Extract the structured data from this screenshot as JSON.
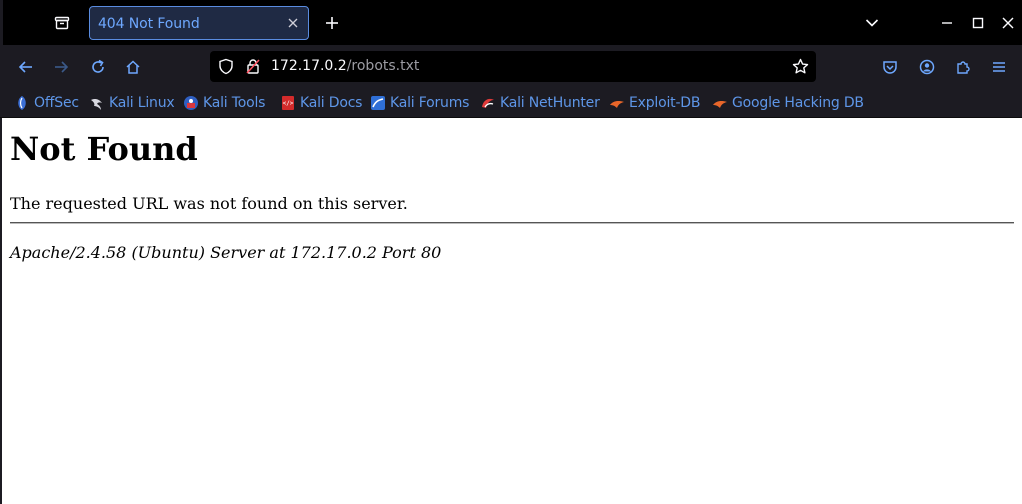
{
  "browser": {
    "tab": {
      "title": "404 Not Found"
    },
    "address_bar": {
      "host": "172.17.0.2",
      "path": "/robots.txt"
    },
    "bookmarks": [
      {
        "label": "OffSec",
        "icon": "offsec-icon"
      },
      {
        "label": "Kali Linux",
        "icon": "kali-dragon-icon"
      },
      {
        "label": "Kali Tools",
        "icon": "kali-tools-icon"
      },
      {
        "label": "Kali Docs",
        "icon": "kali-docs-icon"
      },
      {
        "label": "Kali Forums",
        "icon": "kali-forums-icon"
      },
      {
        "label": "Kali NetHunter",
        "icon": "nethunter-icon"
      },
      {
        "label": "Exploit-DB",
        "icon": "exploit-db-icon"
      },
      {
        "label": "Google Hacking DB",
        "icon": "ghdb-icon"
      }
    ],
    "colors": {
      "accent": "#5e96e8",
      "tab_border": "#5a8ce0",
      "toolbar_bg": "#1c1b22",
      "url_bg": "#000000"
    }
  },
  "page": {
    "heading": "Not Found",
    "message": "The requested URL was not found on this server.",
    "server_signature": "Apache/2.4.58 (Ubuntu) Server at 172.17.0.2 Port 80"
  }
}
